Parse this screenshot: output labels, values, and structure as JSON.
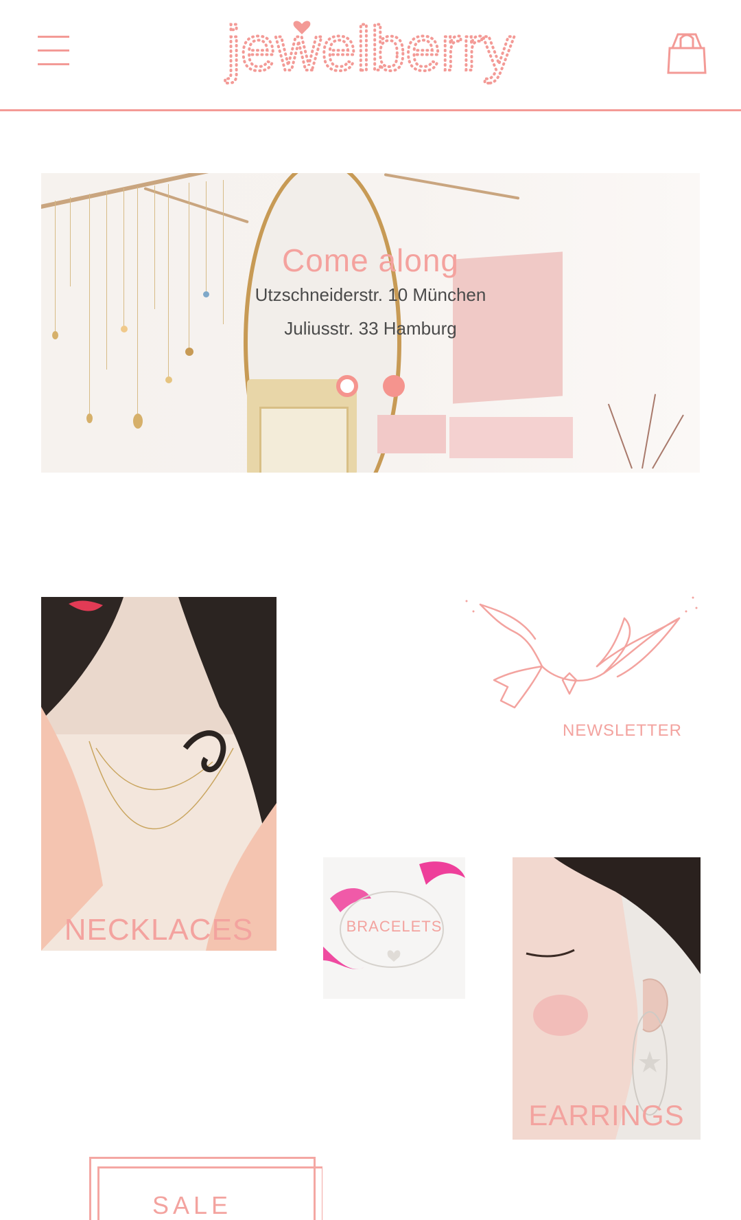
{
  "header": {
    "logo_text": "jewelberry",
    "menu_icon": "hamburger-menu-icon",
    "cart_icon": "shopping-bag-icon"
  },
  "hero": {
    "title": "Come along",
    "line1": "Utzschneiderstr. 10 München",
    "line2": "Juliusstr. 33 Hamburg",
    "slides": 2,
    "active_slide": 2
  },
  "tiles": {
    "necklaces": "NECKLACES",
    "bracelets": "BRACELETS",
    "earrings": "EARRINGS",
    "newsletter": "NEWSLETTER",
    "sale": "SALE"
  },
  "colors": {
    "accent": "#f49a96",
    "text": "#4a4a4a"
  }
}
